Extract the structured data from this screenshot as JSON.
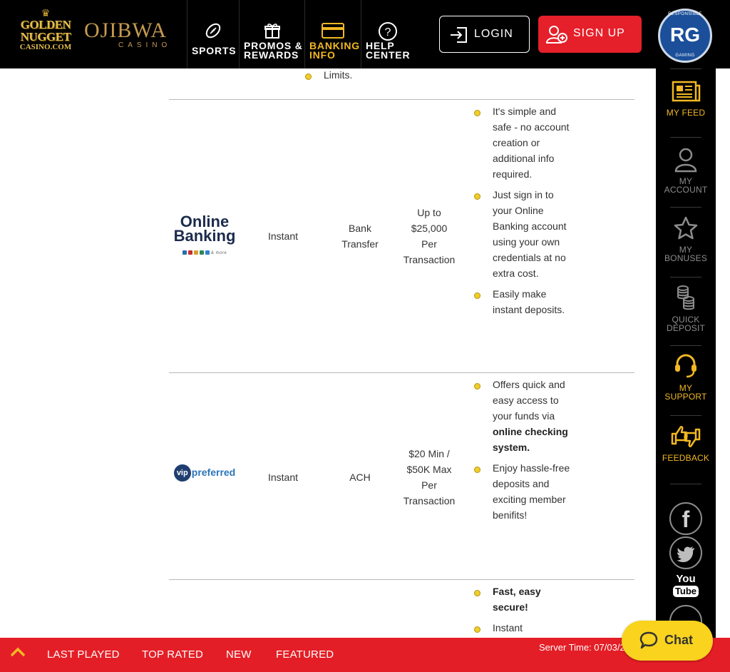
{
  "header": {
    "logo_golden_nugget": {
      "line1": "GOLDEN",
      "line2": "NUGGET",
      "line3": "CASINO.COM"
    },
    "logo_ojibwa": {
      "line1": "OJIBWA",
      "line2": "CASINO"
    },
    "nav": [
      {
        "label_line1": "SPORTS",
        "label_line2": "",
        "icon": "football-icon"
      },
      {
        "label_line1": "PROMOS &",
        "label_line2": "REWARDS",
        "icon": "gift-icon"
      },
      {
        "label_line1": "BANKING",
        "label_line2": "INFO",
        "icon": "card-icon",
        "active": true
      },
      {
        "label_line1": "HELP",
        "label_line2": "CENTER",
        "icon": "question-icon"
      }
    ],
    "login_label": "LOGIN",
    "signup_label": "SIGN UP",
    "rg_badge": {
      "text": "RG",
      "arc_top": "RESPONSIBLE",
      "arc_bottom": "GAMING"
    }
  },
  "sidebar": {
    "items": [
      {
        "label": "MY FEED",
        "icon": "newspaper-icon"
      },
      {
        "label_line1": "MY",
        "label_line2": "ACCOUNT",
        "icon": "user-icon"
      },
      {
        "label_line1": "MY",
        "label_line2": "BONUSES",
        "icon": "star-icon"
      },
      {
        "label_line1": "QUICK",
        "label_line2": "DEPOSIT",
        "icon": "coins-icon"
      },
      {
        "label_line1": "MY",
        "label_line2": "SUPPORT",
        "icon": "headset-icon"
      },
      {
        "label": "FEEDBACK",
        "icon": "thumbs-icon"
      }
    ],
    "social": [
      {
        "label": "f",
        "icon": "facebook-icon"
      },
      {
        "label": "",
        "icon": "twitter-icon"
      },
      {
        "label_line1": "You",
        "label_line2": "Tube",
        "icon": "youtube-icon"
      }
    ]
  },
  "table": {
    "partial_top_text": "Limits.",
    "rows": [
      {
        "logo": {
          "line1": "Online",
          "line2": "Banking",
          "sub": "& more"
        },
        "time": "Instant",
        "method_line1": "Bank",
        "method_line2": "Transfer",
        "limit_lines": [
          "Up to",
          "$25,000",
          "Per",
          "Transaction"
        ],
        "bullets": [
          "It's simple and safe - no account creation or additional info required.",
          "Just sign in to your Online Banking account using your own credentials at no extra cost.",
          "Easily make instant deposits."
        ]
      },
      {
        "logo": {
          "circle": "vip",
          "text": "preferred"
        },
        "time": "Instant",
        "method_line1": "ACH",
        "method_line2": "",
        "limit_lines": [
          "$20 Min /",
          "$50K Max",
          "Per",
          "Transaction"
        ],
        "bullets_rich": {
          "b1_pre": "Offers quick and easy access to your funds via ",
          "b1_bold": "online checking system.",
          "b2": "Enjoy hassle-free deposits and exciting member benifits!"
        }
      },
      {
        "bullets_partial": {
          "b1_bold": "Fast, easy secure!",
          "b2": "Instant"
        }
      }
    ]
  },
  "bottombar": {
    "links": [
      "LAST PLAYED",
      "TOP RATED",
      "NEW",
      "FEATURED"
    ],
    "server_time": "Server Time: 07/03/2"
  },
  "chat": {
    "label": "Chat"
  },
  "colors": {
    "accent_gold": "#f2b823",
    "brand_red": "#e41e26",
    "bullet_yellow": "#f0cd2a",
    "chat_yellow": "#f9d31d"
  }
}
